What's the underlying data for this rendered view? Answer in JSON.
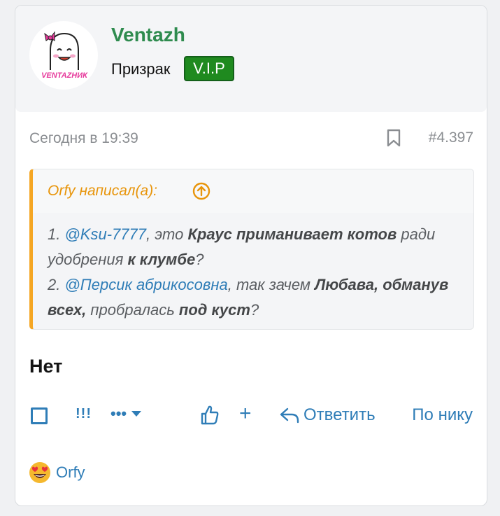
{
  "post": {
    "author": {
      "name": "Ventazh",
      "title": "Призрак",
      "badge": "V.I.P",
      "avatar_text": "VENTAZHИК",
      "avatar_icon": "ghost-avatar"
    },
    "date": "Сегодня в 19:39",
    "number": "#4.397",
    "quote": {
      "author_line": "Orfy написал(а):",
      "line1": {
        "num": "1. ",
        "mention": "@Ksu-7777",
        "t1": ", это ",
        "b1": "Краус приманивает котов",
        "t2": " ради удобрения ",
        "b2": "к клумбе",
        "t3": "?"
      },
      "line2": {
        "num": "2. ",
        "mention": "@Персик абрикосовна",
        "t1": ", так зачем ",
        "b1": "Любава, обманув всех,",
        "t2": " пробралась ",
        "b2": "под куст",
        "t3": "?"
      }
    },
    "message": "Нет",
    "actions": {
      "flags": "!!!",
      "more": "•••",
      "plus": "+",
      "reply": "Ответить",
      "by_nick": "По нику"
    },
    "reactions": [
      {
        "emoji": "😍",
        "user": "Orfy"
      }
    ]
  },
  "colors": {
    "accent": "#2f7db7",
    "username": "#2e8b4e",
    "badge": "#1f8a1f",
    "quote_accent": "#f5a623"
  }
}
